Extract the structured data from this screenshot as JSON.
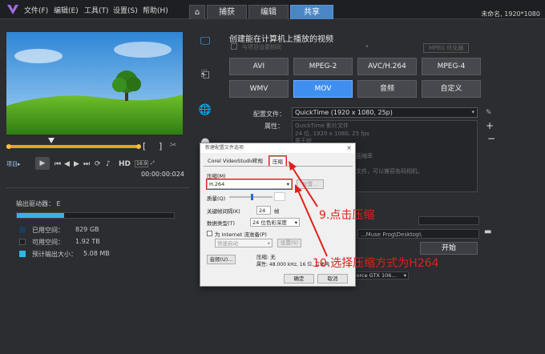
{
  "titlebar": {
    "menus": [
      "文件(F)",
      "编辑(E)",
      "工具(T)",
      "设置(S)",
      "帮助(H)"
    ],
    "tabs": [
      "捕获",
      "编辑",
      "共享"
    ],
    "project": "未命名, 1920*1080"
  },
  "player": {
    "mode_label": "项目▸",
    "hd_label": "HD",
    "zoom": "16:9",
    "timecode": "00:00:00:024"
  },
  "output": {
    "drive_label": "输出驱动器：",
    "drive": "E",
    "used_label": "已用空间：",
    "used_value": "829 GB",
    "free_label": "可用空间：",
    "free_value": "1.92 TB",
    "estimate_label": "预计输出大小：",
    "estimate_value": "5.08 MB"
  },
  "share": {
    "heading": "创建能在计算机上播放的视频",
    "same_as_first": "与项目设置相同",
    "mpeg_optimizer": "MPEG 优化器",
    "formats": [
      "AVI",
      "MPEG-2",
      "AVC/H.264",
      "MPEG-4",
      "WMV",
      "MOV",
      "音频",
      "自定义"
    ],
    "selected_format": "MOV",
    "profile_label": "配置文件：",
    "profile_value": "QuickTime (1920 x 1080, 25p)",
    "props_label": "属性：",
    "props_lines": [
      "QuickTime 影片文件",
      "24 位, 1920 x 1080, 25 fps",
      "基于帧",
      "",
      "压缩率",
      "",
      "文件，可以兼容各码相机。"
    ],
    "file_path": "...Muse Frog\\Desktop\\",
    "start_button": "开始",
    "gpu": "Force GTX 106..."
  },
  "dialog": {
    "title": "新建配置文件选项",
    "tabs": [
      "Corel VideoStudio",
      "常规",
      "压缩"
    ],
    "compression_label": "压缩(M)",
    "compression_value": "H.264",
    "config_button": "配置...",
    "quality_label": "质量(Q)",
    "quality_value": "50",
    "keyframe_label": "关键帧间隔(K)",
    "keyframe_value": "24",
    "keyframe_unit": "帧",
    "datatype_label": "数据类型(T)",
    "datatype_value": "24 位色彩深度",
    "internet_checkbox": "为 Internet 流准备(P)",
    "internet_select": "快速启动",
    "internet_settings": "设置(S)",
    "audio_button": "音频(U)...",
    "audio_compression": "压缩: 无",
    "audio_props": "属性: 48.000 kHz, 16 位, 立体声",
    "ok": "确定",
    "cancel": "取消"
  },
  "annotations": {
    "step9": "9.点击压缩",
    "step10": "10.选择压缩方式为H264"
  },
  "colors": {
    "accent": "#3f8ff0",
    "annotation": "#e32018",
    "progress": "#2fb6e6"
  }
}
